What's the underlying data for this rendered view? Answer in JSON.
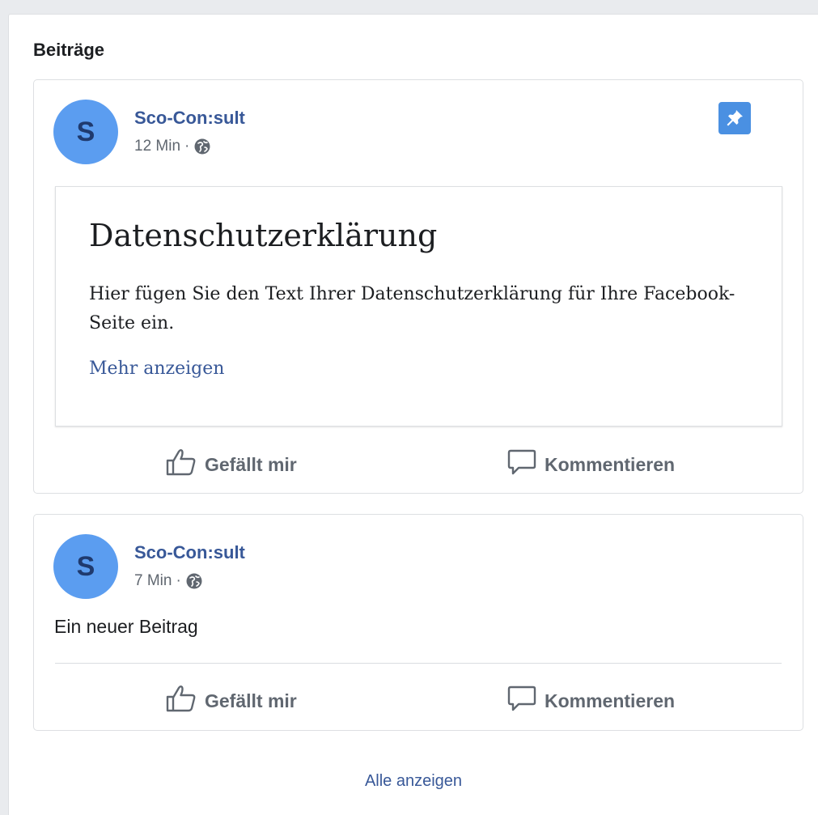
{
  "section_title": "Beiträge",
  "posts": [
    {
      "avatar_letter": "S",
      "author": "Sco-Con:sult",
      "time": "12 Min",
      "separator": "·",
      "privacy_icon": "globe-icon",
      "pinned": true,
      "pin_icon": "pin-icon",
      "note": {
        "title": "Datenschutzerklärung",
        "body": "Hier fügen Sie den Text Ihrer Datenschutzerklärung für Ihre Facebook-Seite ein.",
        "more": "Mehr anzeigen"
      },
      "like_label": "Gefällt mir",
      "comment_label": "Kommentieren"
    },
    {
      "avatar_letter": "S",
      "author": "Sco-Con:sult",
      "time": "7 Min",
      "separator": "·",
      "privacy_icon": "globe-icon",
      "text": "Ein neuer Beitrag",
      "like_label": "Gefällt mir",
      "comment_label": "Kommentieren"
    }
  ],
  "see_all": "Alle anzeigen",
  "colors": {
    "link": "#385898",
    "avatar": "#5b9df0",
    "pin": "#4a90e2",
    "muted": "#606770"
  }
}
